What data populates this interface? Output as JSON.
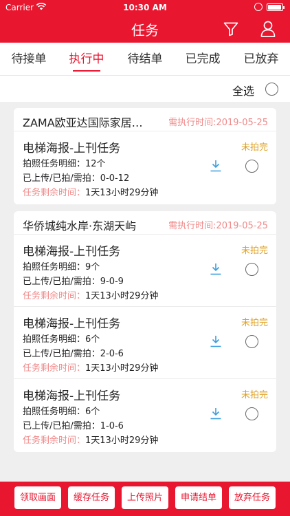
{
  "status_bar": {
    "carrier": "Carrier",
    "time": "10:30 AM"
  },
  "nav": {
    "title": "任务",
    "filter_icon": "filter-icon",
    "user_icon": "user-icon"
  },
  "tabs": [
    {
      "label": "待接单",
      "active": false
    },
    {
      "label": "执行中",
      "active": true
    },
    {
      "label": "待结单",
      "active": false
    },
    {
      "label": "已完成",
      "active": false
    },
    {
      "label": "已放弃",
      "active": false
    }
  ],
  "select_all": {
    "label": "全选"
  },
  "groups": [
    {
      "name": "ZAMA欧亚达国际家居…",
      "date_text": "需执行时间:2019-05-25",
      "tasks": [
        {
          "title": "电梯海报-上刊任务",
          "status": "未拍完",
          "detail": "拍照任务明细：12个",
          "progress": "已上传/已拍/需拍：0-0-12",
          "remaining_label": "任务剩余时间：",
          "remaining_value": "1天13小时29分钟"
        }
      ]
    },
    {
      "name": "华侨城纯水岸·东湖天屿",
      "date_text": "需执行时间:2019-05-25",
      "tasks": [
        {
          "title": "电梯海报-上刊任务",
          "status": "未拍完",
          "detail": "拍照任务明细：9个",
          "progress": "已上传/已拍/需拍：9-0-9",
          "remaining_label": "任务剩余时间：",
          "remaining_value": "1天13小时29分钟"
        },
        {
          "title": "电梯海报-上刊任务",
          "status": "未拍完",
          "detail": "拍照任务明细：6个",
          "progress": "已上传/已拍/需拍：2-0-6",
          "remaining_label": "任务剩余时间：",
          "remaining_value": "1天13小时29分钟"
        },
        {
          "title": "电梯海报-上刊任务",
          "status": "未拍完",
          "detail": "拍照任务明细：6个",
          "progress": "已上传/已拍/需拍：1-0-6",
          "remaining_label": "任务剩余时间：",
          "remaining_value": "1天13小时29分钟"
        }
      ]
    }
  ],
  "bottom_actions": [
    {
      "label": "领取画面"
    },
    {
      "label": "缓存任务"
    },
    {
      "label": "上传照片"
    },
    {
      "label": "申请结单"
    },
    {
      "label": "放弃任务"
    }
  ],
  "colors": {
    "brand": "#e8162f",
    "accent_text": "#f08a8a",
    "status": "#e0a020",
    "download_icon": "#3a9ee0"
  }
}
